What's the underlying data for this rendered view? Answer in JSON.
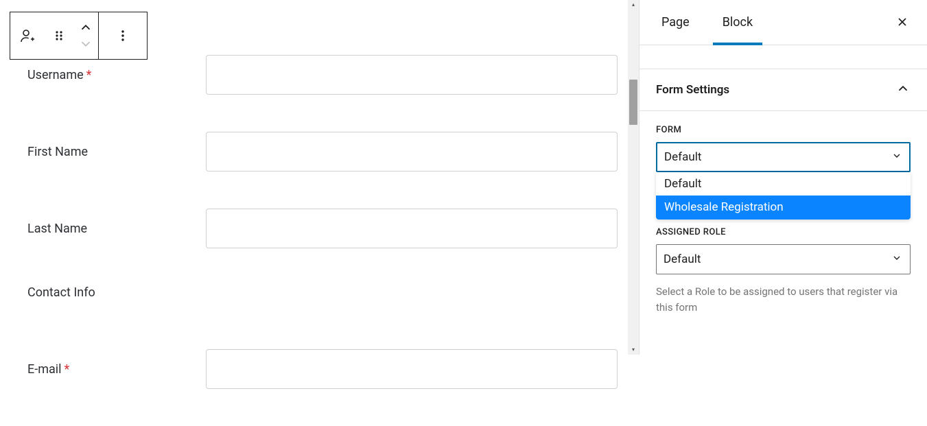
{
  "toolbar": {
    "block_icon_name": "user-plus-icon",
    "drag_icon_name": "drag-handle-icon",
    "move_up_name": "chevron-up-icon",
    "move_down_name": "chevron-down-icon",
    "more_icon_name": "more-vertical-icon"
  },
  "form": {
    "fields": [
      {
        "label": "Username",
        "required": true,
        "has_input": true
      },
      {
        "label": "First Name",
        "required": false,
        "has_input": true
      },
      {
        "label": "Last Name",
        "required": false,
        "has_input": true
      },
      {
        "label": "Contact Info",
        "required": false,
        "has_input": false
      },
      {
        "label": "E-mail",
        "required": true,
        "has_input": true
      }
    ]
  },
  "sidebar": {
    "tabs": {
      "page": "Page",
      "block": "Block",
      "active": "block"
    },
    "close_icon_name": "close-icon",
    "panel_title": "Form Settings",
    "form_select": {
      "label": "FORM",
      "selected": "Default",
      "options": [
        "Default",
        "Wholesale Registration"
      ],
      "highlighted_index": 1,
      "open": true
    },
    "role_select": {
      "label": "ASSIGNED ROLE",
      "selected": "Default",
      "help": "Select a Role to be assigned to users that register via this form"
    }
  }
}
